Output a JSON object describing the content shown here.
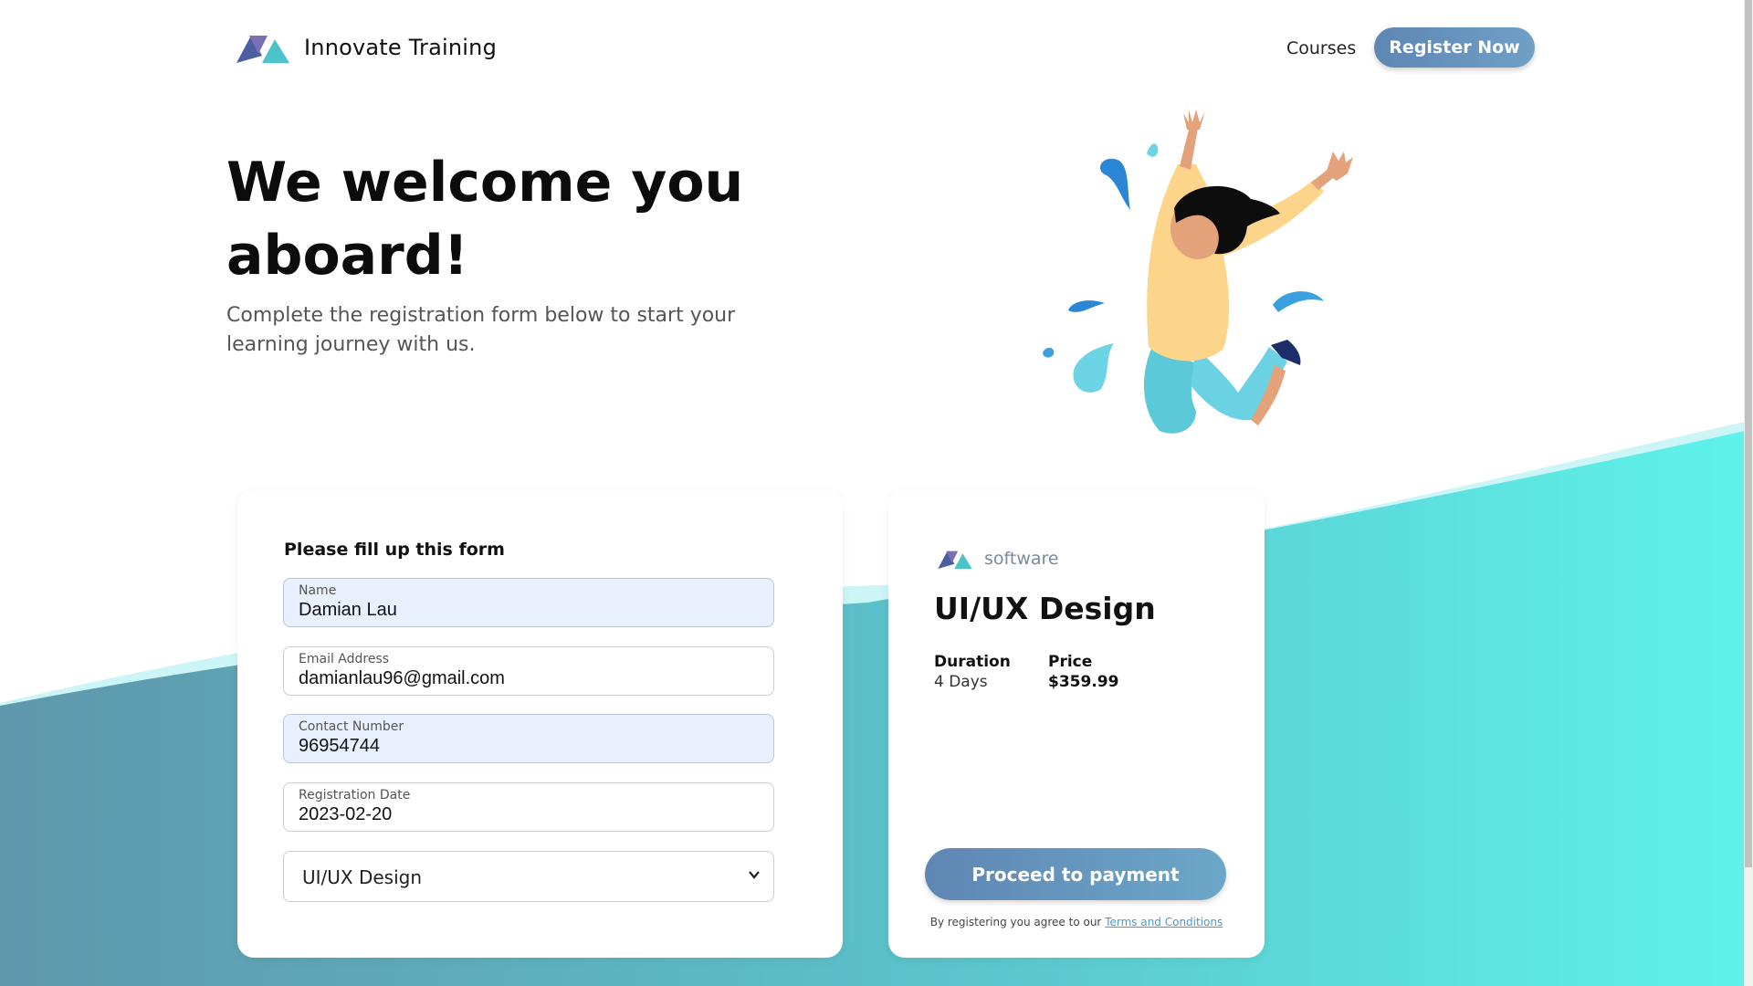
{
  "header": {
    "brand": "Innovate Training",
    "nav_courses": "Courses",
    "register_button": "Register Now"
  },
  "hero": {
    "title": "We welcome you aboard!",
    "subtitle": "Complete the registration form below to start your learning journey with us."
  },
  "form": {
    "heading": "Please fill up this form",
    "fields": [
      {
        "label": "Name",
        "value": "Damian Lau"
      },
      {
        "label": "Email Address",
        "value": "damianlau96@gmail.com"
      },
      {
        "label": "Contact Number",
        "value": "96954744"
      },
      {
        "label": "Registration Date",
        "value": "2023-02-20"
      }
    ],
    "course_select": "UI/UX Design"
  },
  "course": {
    "category": "software",
    "name": "UI/UX Design",
    "duration_label": "Duration",
    "duration_value": "4 Days",
    "price_label": "Price",
    "price_value": "$359.99",
    "pay_button": "Proceed to payment",
    "terms_prefix": "By registering you agree to our",
    "terms_link": "Terms and Conditions"
  },
  "colors": {
    "accent": "#6b95bd",
    "wave_dark": "#5e9fb2",
    "wave_light": "#5ef0e6",
    "autofill": "#e8f0fe"
  },
  "icons": {
    "logo": "triangle-logo-icon",
    "select": "chevron-down-icon"
  }
}
